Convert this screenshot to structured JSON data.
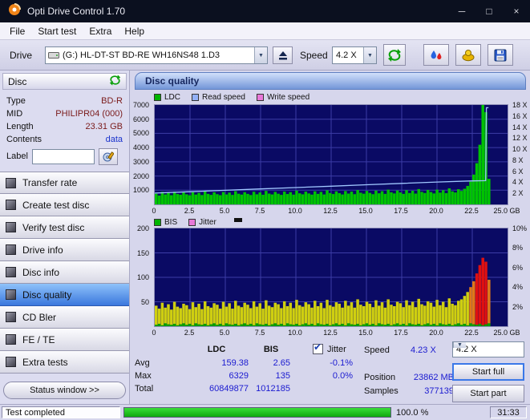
{
  "window": {
    "title": "Opti Drive Control 1.70"
  },
  "menu": {
    "items": [
      "File",
      "Start test",
      "Extra",
      "Help"
    ]
  },
  "toolbar": {
    "drive_label": "Drive",
    "drive_value": "(G:)  HL-DT-ST BD-RE  WH16NS48 1.D3",
    "speed_label": "Speed",
    "speed_value": "4.2 X"
  },
  "sidebar": {
    "header": "Disc",
    "info": [
      {
        "label": "Type",
        "value": "BD-R",
        "color": "#7a1a1a"
      },
      {
        "label": "MID",
        "value": "PHILIPR04 (000)",
        "color": "#7a1a1a"
      },
      {
        "label": "Length",
        "value": "23.31 GB",
        "color": "#7a1a1a"
      },
      {
        "label": "Contents",
        "value": "data",
        "color": "#1a33cc"
      }
    ],
    "label_caption": "Label",
    "label_value": "",
    "nav": [
      "Transfer rate",
      "Create test disc",
      "Verify test disc",
      "Drive info",
      "Disc info",
      "Disc quality",
      "CD Bler",
      "FE / TE",
      "Extra tests"
    ],
    "selected_nav": "Disc quality",
    "status_window": "Status window >>"
  },
  "panel": {
    "title": "Disc quality"
  },
  "chart_data": [
    {
      "type": "bar+line",
      "title": "LDC / Read speed",
      "legend": [
        {
          "label": "LDC",
          "color": "#00b400"
        },
        {
          "label": "Read speed",
          "color": "#93b1f8"
        },
        {
          "label": "Write speed",
          "color": "#e878d8"
        }
      ],
      "y_left": {
        "ticks": [
          "7000",
          "6000",
          "5000",
          "4000",
          "3000",
          "2000",
          "1000"
        ],
        "max": 7000
      },
      "y_right": {
        "ticks": [
          "18 X",
          "16 X",
          "14 X",
          "12 X",
          "10 X",
          "8 X",
          "6 X",
          "4 X",
          "2 X"
        ],
        "max": 18
      },
      "x_ticks": [
        "0",
        "2.5",
        "5.0",
        "7.5",
        "10.0",
        "12.5",
        "15.0",
        "17.5",
        "20.0",
        "22.5",
        "25.0 GB"
      ],
      "x_max_gb": 25,
      "data_end_gb": 23.8,
      "ldc_values": [
        750,
        620,
        880,
        700,
        820,
        650,
        900,
        730,
        680,
        840,
        710,
        640,
        860,
        690,
        810,
        660,
        920,
        740,
        670,
        850,
        720,
        650,
        870,
        700,
        830,
        670,
        930,
        750,
        690,
        860,
        740,
        660,
        890,
        710,
        840,
        680,
        950,
        760,
        700,
        880,
        750,
        670,
        900,
        730,
        860,
        690,
        970,
        780,
        710,
        900,
        770,
        690,
        920,
        740,
        880,
        700,
        990,
        800,
        730,
        920,
        790,
        700,
        940,
        760,
        900,
        720,
        1010,
        820,
        750,
        950,
        810,
        720,
        970,
        780,
        930,
        740,
        1040,
        850,
        770,
        980,
        840,
        740,
        1000,
        800,
        960,
        760,
        1080,
        880,
        800,
        1020,
        870,
        770,
        1040,
        830,
        1000,
        790,
        1130,
        920,
        840,
        1070,
        950,
        1100,
        1300,
        1600,
        2100,
        2900,
        4200,
        7000,
        6500,
        1800
      ],
      "read_speed_x": [
        [
          0,
          2.05
        ],
        [
          2.5,
          2.3
        ],
        [
          5,
          2.55
        ],
        [
          7.5,
          2.8
        ],
        [
          10,
          3.05
        ],
        [
          12.5,
          3.3
        ],
        [
          15,
          3.55
        ],
        [
          17.5,
          3.8
        ],
        [
          20,
          4.05
        ],
        [
          22.5,
          4.25
        ],
        [
          23.45,
          4.3
        ],
        [
          23.5,
          17.5
        ],
        [
          23.65,
          17.5
        ]
      ]
    },
    {
      "type": "bar",
      "title": "BIS / Jitter",
      "legend": [
        {
          "label": "BIS",
          "color": "#00b400"
        },
        {
          "label": "Jitter",
          "color": "#e878d8"
        }
      ],
      "y_left": {
        "ticks": [
          "200",
          "150",
          "100",
          "50"
        ],
        "max": 200
      },
      "y_right": {
        "ticks": [
          "10%",
          "8%",
          "6%",
          "4%",
          "2%"
        ],
        "max": 10
      },
      "x_ticks": [
        "0",
        "2.5",
        "5.0",
        "7.5",
        "10.0",
        "12.5",
        "15.0",
        "17.5",
        "20.0",
        "22.5",
        "25.0 GB"
      ],
      "x_max_gb": 25,
      "data_end_gb": 23.8,
      "jitter_values": [
        42,
        36,
        48,
        38,
        45,
        34,
        50,
        40,
        37,
        46,
        43,
        35,
        49,
        39,
        46,
        35,
        51,
        41,
        38,
        47,
        44,
        36,
        50,
        40,
        47,
        36,
        52,
        42,
        39,
        48,
        44,
        37,
        51,
        40,
        47,
        36,
        53,
        42,
        39,
        48,
        45,
        37,
        51,
        41,
        48,
        37,
        54,
        43,
        40,
        49,
        45,
        38,
        52,
        41,
        48,
        37,
        54,
        43,
        40,
        49,
        46,
        38,
        52,
        42,
        49,
        38,
        55,
        44,
        41,
        50,
        46,
        39,
        53,
        42,
        49,
        38,
        55,
        44,
        41,
        50,
        47,
        39,
        53,
        43,
        50,
        39,
        56,
        45,
        42,
        51,
        48,
        40,
        54,
        43,
        50,
        39,
        57,
        46,
        43,
        52,
        55,
        62,
        70,
        80,
        92,
        108,
        125,
        140,
        132,
        95
      ],
      "bis_values": [
        3,
        5,
        2,
        6,
        4,
        3,
        5,
        2,
        4,
        6,
        3,
        5,
        2,
        6,
        4,
        3,
        5,
        2,
        4,
        6,
        3,
        5,
        2,
        6,
        4,
        3,
        5,
        2,
        4,
        6,
        3,
        5,
        2,
        6,
        4,
        3,
        5,
        2,
        4,
        6,
        3,
        5,
        2,
        6,
        4,
        3,
        5,
        2,
        4,
        6,
        3,
        5,
        2,
        6,
        4,
        3,
        5,
        2,
        4,
        6,
        3,
        5,
        2,
        6,
        4,
        3,
        5,
        2,
        4,
        6,
        3,
        5,
        2,
        6,
        4,
        3,
        5,
        2,
        4,
        6,
        3,
        5,
        2,
        6,
        4,
        3,
        5,
        2,
        4,
        6,
        3,
        5,
        2,
        6,
        4,
        3,
        5,
        2,
        4,
        6,
        3,
        5,
        2,
        6,
        4,
        3,
        5,
        2,
        4,
        6
      ]
    }
  ],
  "stats": {
    "col1_header": "LDC",
    "col2_header": "BIS",
    "jitter_label": "Jitter",
    "jitter_checked": true,
    "rows": [
      {
        "label": "Avg",
        "ldc": "159.38",
        "bis": "2.65",
        "jitter": "-0.1%"
      },
      {
        "label": "Max",
        "ldc": "6329",
        "bis": "135",
        "jitter": "0.0%"
      },
      {
        "label": "Total",
        "ldc": "60849877",
        "bis": "1012185",
        "jitter": ""
      }
    ],
    "speed_label": "Speed",
    "speed_value": "4.23 X",
    "speed_select": "4.2 X",
    "position_label": "Position",
    "position_value": "23862 MB",
    "samples_label": "Samples",
    "samples_value": "377139",
    "start_full_label": "Start full",
    "start_part_label": "Start part"
  },
  "statusbar": {
    "text": "Test completed",
    "progress_percent": 100,
    "percent_label": "100.0 %",
    "time": "31:33"
  }
}
